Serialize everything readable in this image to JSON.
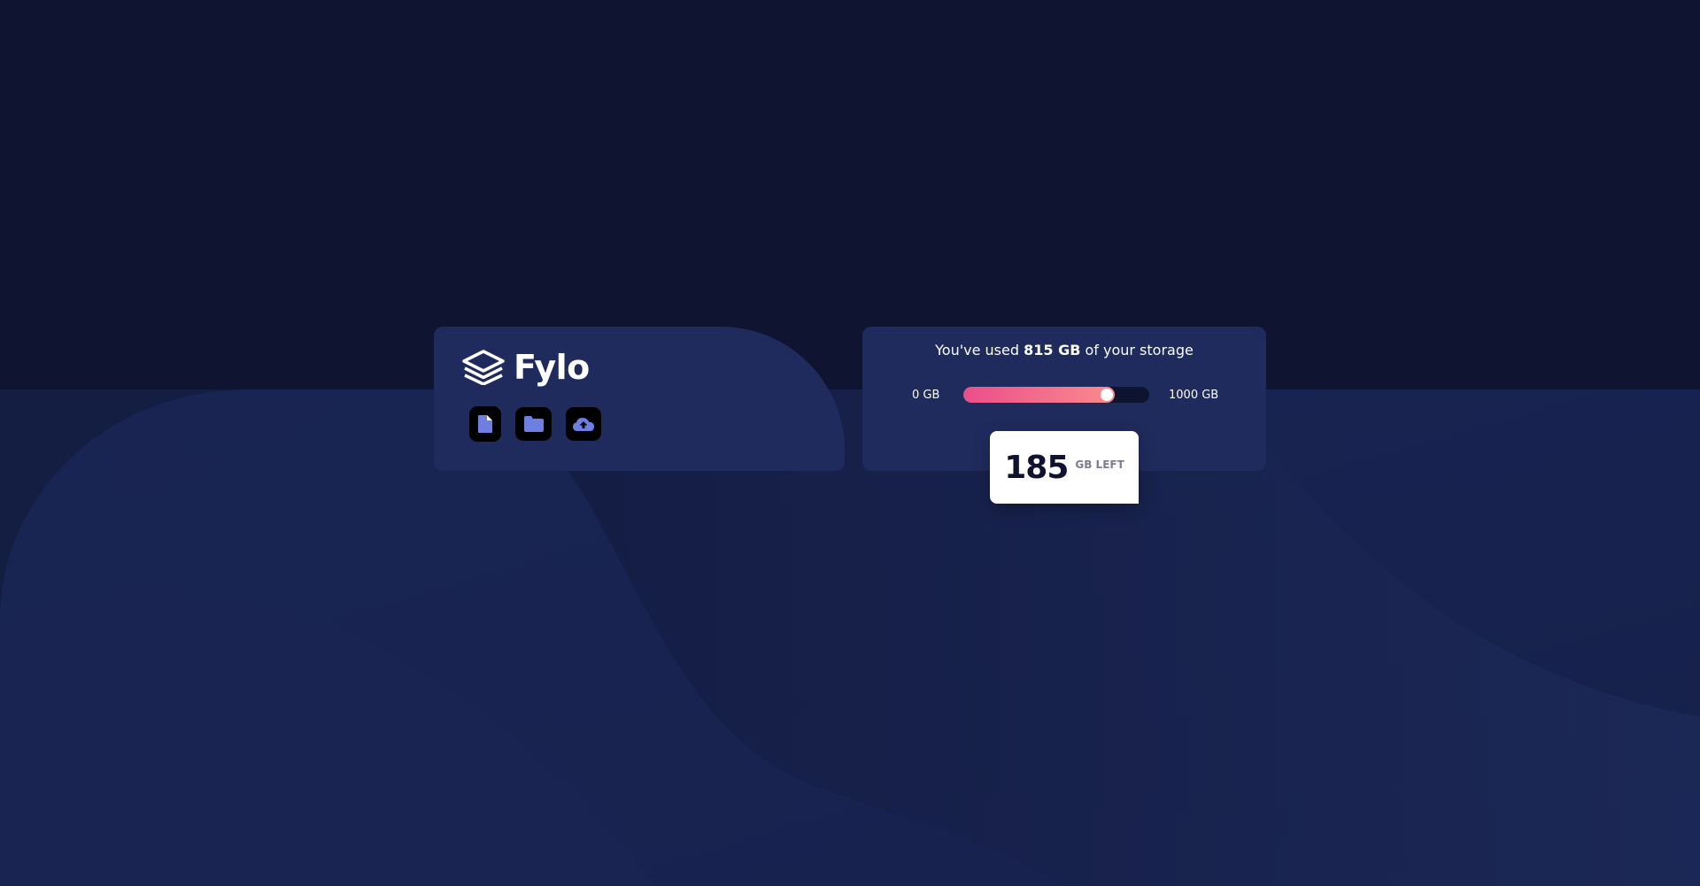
{
  "brand": {
    "name": "Fylo",
    "icon": "fylo-layers-icon"
  },
  "actions": [
    {
      "icon": "document-icon"
    },
    {
      "icon": "folder-icon"
    },
    {
      "icon": "upload-icon"
    }
  ],
  "storage": {
    "prefix": "You've used ",
    "used": "815 GB",
    "suffix": " of your storage",
    "min_label": "0 GB",
    "max_label": "1000 GB",
    "used_fraction": 0.815,
    "left_number": "185",
    "left_unit": "GB LEFT"
  },
  "colors": {
    "background": "#0f1530",
    "card": "#1f2b5c",
    "bar_start": "#eb4e8a",
    "bar_end": "#f98c8c",
    "icon_accent": "#6d7fe0"
  }
}
